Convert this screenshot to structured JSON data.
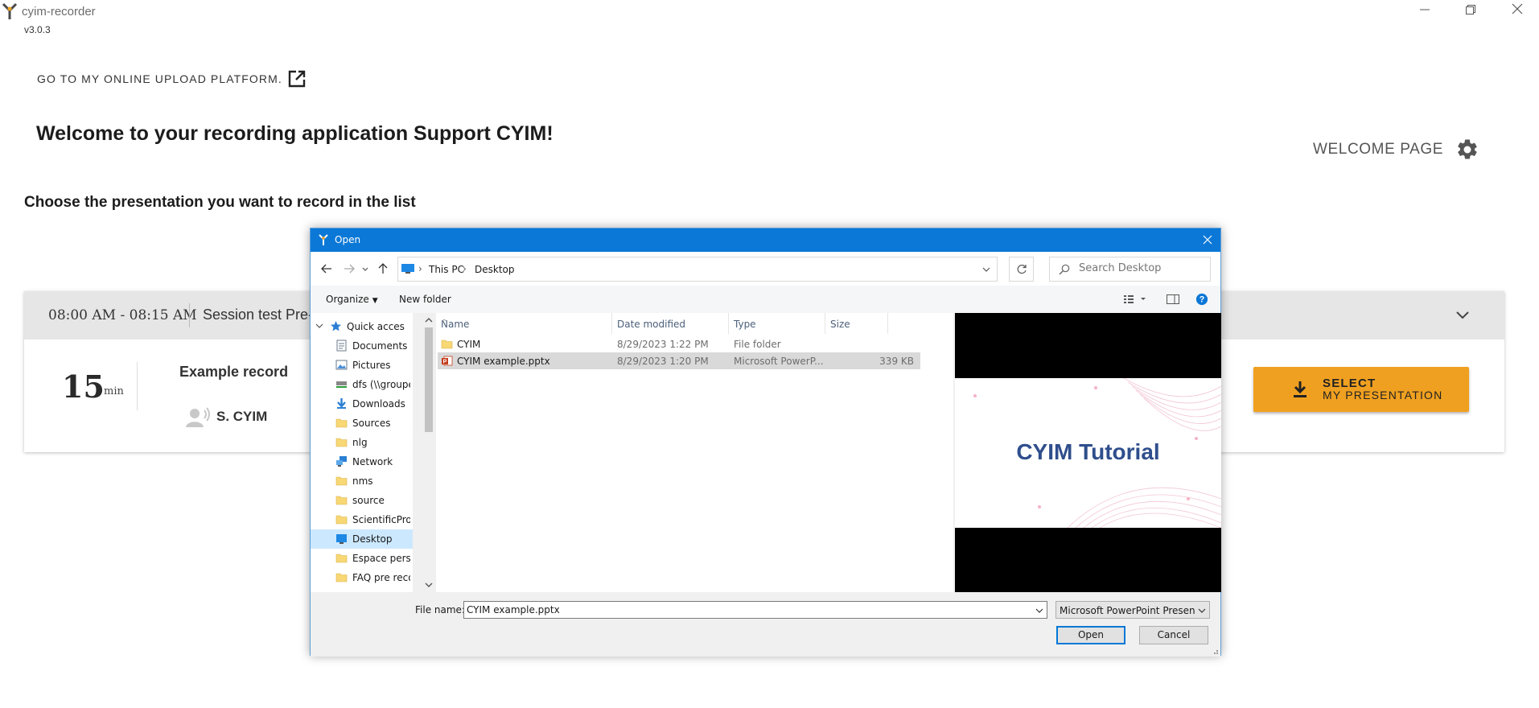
{
  "app": {
    "name": "cyim-recorder",
    "version": "v3.0.3",
    "upload_link": "GO TO MY ONLINE UPLOAD PLATFORM.",
    "welcome_title": "Welcome to your recording application Support CYIM!",
    "welcome_page": "WELCOME PAGE",
    "choose_title": "Choose the presentation you want to record in the list"
  },
  "session": {
    "time": "08:00 AM - 08:15 AM",
    "title": "Session test Pre-",
    "duration": "15",
    "duration_unit": "min",
    "record_name": "Example record",
    "speaker": "S. CYIM",
    "select_line1": "SELECT",
    "select_line2": "MY PRESENTATION",
    "accent": "#f0a020"
  },
  "dialog": {
    "title": "Open",
    "address": [
      "This PC",
      "Desktop"
    ],
    "search_placeholder": "Search Desktop",
    "toolbar": {
      "organize": "Organize",
      "new_folder": "New folder"
    },
    "nav_items": [
      {
        "label": "Quick access",
        "icon": "star-icon",
        "pinned": false
      },
      {
        "label": "Documents",
        "icon": "documents-icon",
        "pinned": true
      },
      {
        "label": "Pictures",
        "icon": "pictures-icon",
        "pinned": true
      },
      {
        "label": "dfs (\\\\groupe",
        "icon": "network-drive-icon",
        "pinned": true
      },
      {
        "label": "Downloads",
        "icon": "download-icon",
        "pinned": true
      },
      {
        "label": "Sources",
        "icon": "folder-icon",
        "pinned": true
      },
      {
        "label": "nlg",
        "icon": "folder-icon",
        "pinned": true
      },
      {
        "label": "Network",
        "icon": "network-icon",
        "pinned": true
      },
      {
        "label": "nms",
        "icon": "folder-icon",
        "pinned": true
      },
      {
        "label": "source",
        "icon": "folder-icon",
        "pinned": true
      },
      {
        "label": "ScientificProc",
        "icon": "folder-icon",
        "pinned": true
      },
      {
        "label": "Desktop",
        "icon": "desktop-icon",
        "pinned": false,
        "selected": true
      },
      {
        "label": "Espace perso EN",
        "icon": "folder-icon",
        "pinned": false
      },
      {
        "label": "FAQ pre record f",
        "icon": "folder-icon",
        "pinned": false
      }
    ],
    "columns": [
      "Name",
      "Date modified",
      "Type",
      "Size"
    ],
    "files": [
      {
        "name": "CYIM",
        "date": "8/29/2023 1:22 PM",
        "type": "File folder",
        "size": "",
        "icon": "folder-icon"
      },
      {
        "name": "CYIM example.pptx",
        "date": "8/29/2023 1:20 PM",
        "type": "Microsoft PowerP...",
        "size": "339 KB",
        "icon": "powerpoint-icon",
        "selected": true
      }
    ],
    "preview_title": "CYIM Tutorial",
    "file_name_label": "File name:",
    "file_name_value": "CYIM example.pptx",
    "file_type": "Microsoft PowerPoint Presentation",
    "open_label": "Open",
    "cancel_label": "Cancel"
  }
}
